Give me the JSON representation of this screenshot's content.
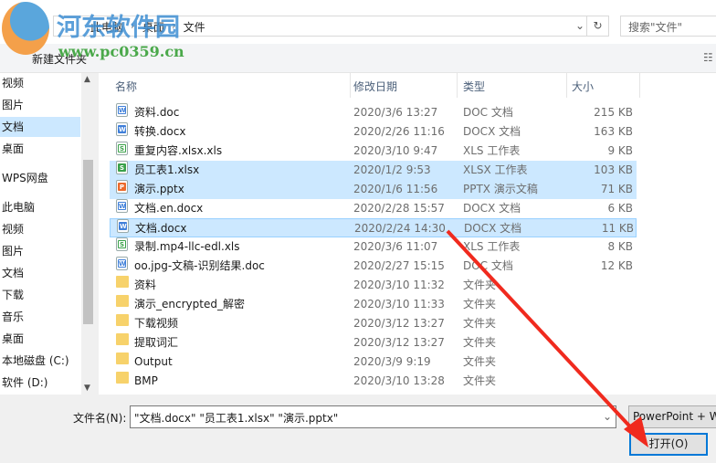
{
  "watermark": {
    "title": "河东软件园",
    "url": "www.pc0359.cn"
  },
  "address": {
    "crumbs": [
      "此电脑",
      "桌面",
      "文件"
    ]
  },
  "search": {
    "placeholder": "搜索\"文件\""
  },
  "toolbar": {
    "new_folder": "新建文件夹"
  },
  "sidebar": [
    "视频",
    "图片",
    "文档",
    "桌面",
    "WPS网盘",
    "此电脑",
    "视频",
    "图片",
    "文档",
    "下载",
    "音乐",
    "桌面",
    "本地磁盘 (C:)",
    "软件 (D:)"
  ],
  "columns": {
    "name": "名称",
    "date": "修改日期",
    "type": "类型",
    "size": "大小"
  },
  "files": [
    {
      "name": "资料.doc",
      "date": "2020/3/6 13:27",
      "type": "DOC 文档",
      "size": "215 KB",
      "icon": "word"
    },
    {
      "name": "转换.docx",
      "date": "2020/2/26 11:16",
      "type": "DOCX 文档",
      "size": "163 KB",
      "icon": "word"
    },
    {
      "name": "重复内容.xlsx.xls",
      "date": "2020/3/10 9:47",
      "type": "XLS 工作表",
      "size": "9 KB",
      "icon": "excel"
    },
    {
      "name": "员工表1.xlsx",
      "date": "2020/1/2 9:53",
      "type": "XLSX 工作表",
      "size": "103 KB",
      "icon": "excel"
    },
    {
      "name": "演示.pptx",
      "date": "2020/1/6 11:56",
      "type": "PPTX 演示文稿",
      "size": "71 KB",
      "icon": "ppt"
    },
    {
      "name": "文档.en.docx",
      "date": "2020/2/28 15:57",
      "type": "DOCX 文档",
      "size": "6 KB",
      "icon": "word"
    },
    {
      "name": "文档.docx",
      "date": "2020/2/24 14:30",
      "type": "DOCX 文档",
      "size": "11 KB",
      "icon": "word"
    },
    {
      "name": "录制.mp4-llc-edl.xls",
      "date": "2020/3/6 11:07",
      "type": "XLS 工作表",
      "size": "8 KB",
      "icon": "excel"
    },
    {
      "name": "oo.jpg-文稿-识别结果.doc",
      "date": "2020/2/27 15:15",
      "type": "DOC 文档",
      "size": "12 KB",
      "icon": "word"
    },
    {
      "name": "资料",
      "date": "2020/3/10 11:32",
      "type": "文件夹",
      "size": "",
      "icon": "folder"
    },
    {
      "name": "演示_encrypted_解密",
      "date": "2020/3/10 11:33",
      "type": "文件夹",
      "size": "",
      "icon": "folder"
    },
    {
      "name": "下载视频",
      "date": "2020/3/12 13:27",
      "type": "文件夹",
      "size": "",
      "icon": "folder"
    },
    {
      "name": "提取词汇",
      "date": "2020/3/12 13:27",
      "type": "文件夹",
      "size": "",
      "icon": "folder"
    },
    {
      "name": "Output",
      "date": "2020/3/9 9:19",
      "type": "文件夹",
      "size": "",
      "icon": "folder"
    },
    {
      "name": "BMP",
      "date": "2020/3/10 13:28",
      "type": "文件夹",
      "size": "",
      "icon": "folder"
    }
  ],
  "selected": [
    3,
    4,
    6
  ],
  "footer": {
    "filename_label": "文件名(N):",
    "filename_value": "\"文档.docx\" \"员工表1.xlsx\" \"演示.pptx\"",
    "filetype": "PowerPoint + W",
    "open": "打开(O)"
  },
  "colors": {
    "selection": "#cce8ff",
    "accent": "#0078d7",
    "arrow": "#f02a1e"
  }
}
